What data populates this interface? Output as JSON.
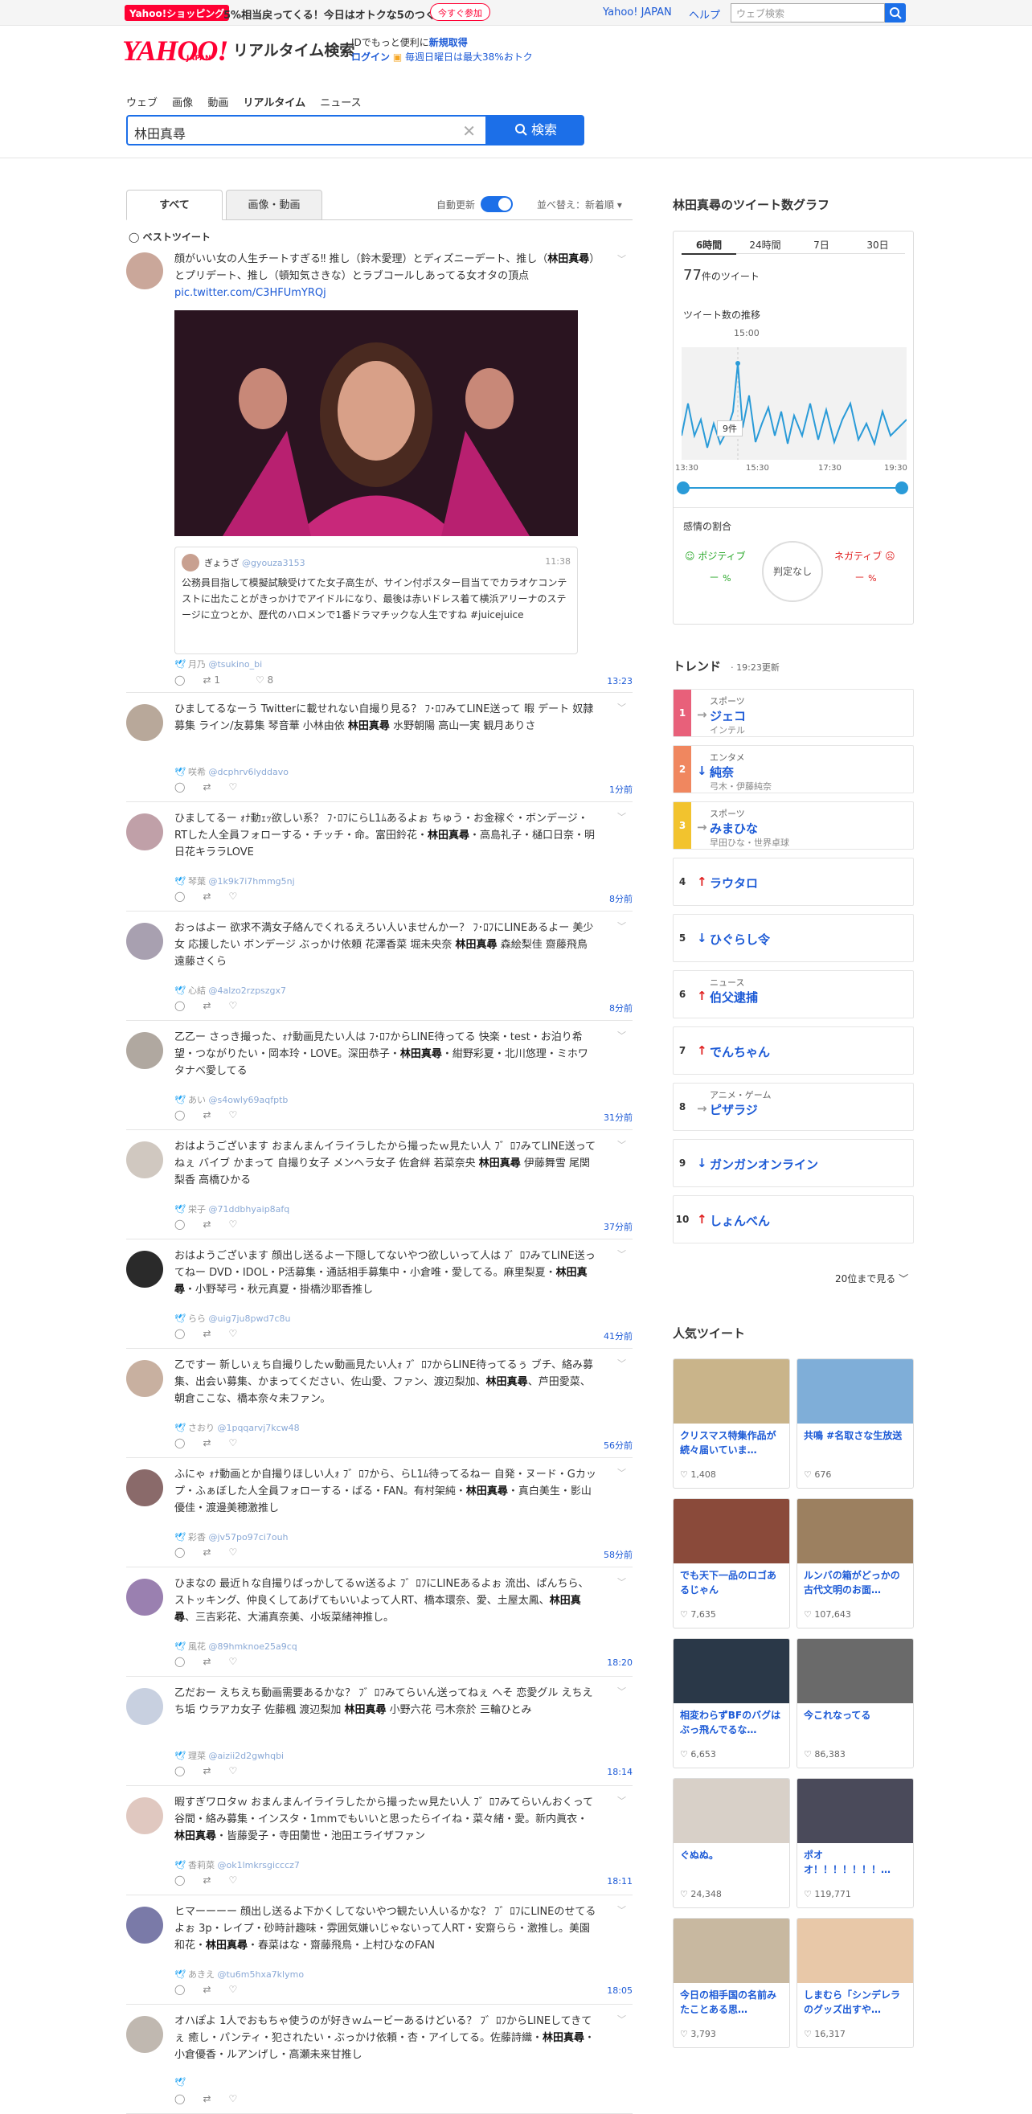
{
  "header": {
    "promo_badge": "Yahoo!ショッピング",
    "promo_text": "5%相当戻ってくる！今日はオトクな5のつく日",
    "promo_button": "今すぐ参加",
    "links": [
      "Yahoo! JAPAN",
      "ヘルプ"
    ],
    "top_search_placeholder": "ウェブ検索",
    "logo": "YAHOO!",
    "logo_sub": "JAPAN",
    "service_title": "リアルタイム検索",
    "login_line1_prefix": "IDでもっと便利に",
    "login_line1_link": "新規取得",
    "login_link": "ログイン",
    "login_promo": "毎週日曜日は最大38%おトク"
  },
  "nav": [
    "ウェブ",
    "画像",
    "動画",
    "リアルタイム",
    "ニュース"
  ],
  "search": {
    "value": "林田真尋",
    "button": "検索"
  },
  "tabs": {
    "all": "すべて",
    "media": "画像・動画",
    "auto_update": "自動更新",
    "sort": "並べ替え：新着順"
  },
  "best_tweet_label": "ベストツイート",
  "tweets": [
    {
      "body_pre": "顔がいい女の人生チートすぎる‼︎ 推し（鈴木愛理）とディズニーデート、推し（",
      "kw": "林田真尋",
      "body_post": "）とプリデート、推し（頓知気さきな）とラブコールしあってる女オタの頂点 ",
      "link": "pic.twitter.com/C3HFUmYRQj",
      "user": "月乃",
      "handle": "@tsukino_bi",
      "retweets": "1",
      "likes": "8",
      "time": "13:23",
      "quote": {
        "user": "ぎょうざ",
        "handle": "@gyouza3153",
        "time": "11:38",
        "text": "公務員目指して模擬試験受けてた女子高生が、サイン付ポスター目当てでカラオケコンテストに出たことがきっかけでアイドルになり、最後は赤いドレス着て横浜アリーナのステージに立つとか、歴代のハロメンで1番ドラマチックな人生ですね #juicejuice"
      }
    },
    {
      "body_pre": "ひましてるなーう Twitterに載せれない自撮り見る？ ﾌ･ﾛﾌみてLINE送って 暇 デート 奴隷募集 ライン/友募集 琴音華 小林由依 ",
      "kw": "林田真尋",
      "body_post": " 水野朝陽 高山一実 観月ありさ",
      "user": "咲希",
      "handle": "@dcphrv6lyddavo",
      "time": "1分前"
    },
    {
      "body_pre": "ひましてるー ｫﾅ動ｪｯ欲しい系？ ﾌ･ﾛﾌにらL1ﾑあるよぉ ちゅう・お金稼ぐ・ボンデージ・RTした人全員フォローする・チッチ・命。富田鈴花・",
      "kw": "林田真尋",
      "body_post": "・高島礼子・樋口日奈・明日花キララLOVE",
      "user": "琴葉",
      "handle": "@1k9k7i7hmmg5nj",
      "time": "8分前"
    },
    {
      "body_pre": "おっはよー 欲求不満女子絡んでくれるえろい人いませんかー？ ﾌ･ﾛﾌにLINEあるよー 美少女 応援したい ボンデージ ぶっかけ依頼 花澤香菜 堀未央奈 ",
      "kw": "林田真尋",
      "body_post": " 森絵梨佳 齋藤飛鳥 遠藤さくら",
      "user": "心結",
      "handle": "@4alzo2rzpszgx7",
      "time": "8分前"
    },
    {
      "body_pre": "乙乙ー さっき撮った、ｫﾅ動画見たい人は ﾌ･ﾛﾌからLINE待ってる 快楽・test・お泊り希望・つながりたい・岡本玲・LOVE。深田恭子・",
      "kw": "林田真尋",
      "body_post": "・紺野彩夏・北川悠理・ミホワタナベ愛してる",
      "user": "あい",
      "handle": "@s4owly69aqfptb",
      "time": "31分前"
    },
    {
      "body_pre": "おはようございます おまんまんイライラしたから撮ったｗ見たい人 ﾌ゛ﾛﾌみてLINE送ってねぇ バイブ かまって 自撮り女子 メンヘラ女子 佐倉絆 若菜奈央 ",
      "kw": "林田真尋",
      "body_post": " 伊藤舞雪 尾関梨香 高橋ひかる",
      "user": "栄子",
      "handle": "@71ddbhyaip8afq",
      "time": "37分前"
    },
    {
      "body_pre": "おはようございます 顔出し送るよー下隠してないやつ欲しいって人は ﾌ゛ﾛﾌみてLINE送ってねー DVD・IDOL・P活募集・通話相手募集中・小倉唯・愛してる。麻里梨夏・",
      "kw": "林田真尋",
      "body_post": "・小野琴弓・秋元真夏・掛橋沙耶香推し",
      "user": "らら",
      "handle": "@uig7ju8pwd7c8u",
      "time": "41分前"
    },
    {
      "body_pre": "乙ですー 新しいぇち自撮りしたｗ動画見たい人ｫ ﾌ゛ﾛﾌからLINE待ってるぅ ブチ、絡み募集、出会い募集、かまってください、佐山愛、ファン、渡辺梨加、",
      "kw": "林田真尋",
      "body_post": "、芦田愛菜、朝倉ここな、橋本奈々未ファン。",
      "user": "さおり",
      "handle": "@1pqqarvj7kcw48",
      "time": "56分前"
    },
    {
      "body_pre": "ふにゃ ｫﾅ動画とか自撮りほしい人ｫ ﾌ゛ﾛﾌから、らL1ﾑ待ってるねー 自発・ヌード・Gカップ・ふぁぼした人全員フォローする・ばる・FAN。有村架純・",
      "kw": "林田真尋",
      "body_post": "・真白美生・影山優佳・渡邊美穂激推し",
      "user": "彩香",
      "handle": "@jv57po97ci7ouh",
      "time": "58分前"
    },
    {
      "body_pre": "ひまなの 最近ｈな自撮りばっかしてるｗ送るよ ﾌ゛ﾛﾌにLINEあるよぉ 流出、ぱんちら、ストッキング、仲良くしてあげてもいいよって人RT、橋本環奈、愛、土屋太鳳、",
      "kw": "林田真尋",
      "body_post": "、三吉彩花、大浦真奈美、小坂菜緒神推し。",
      "user": "風花",
      "handle": "@89hmknoe25a9cq",
      "time": "18:20"
    },
    {
      "body_pre": "乙だおー えちえち動画需要あるかな？ ﾌ゛ﾛﾌみてらいん送ってねぇ へそ 恋愛グル えちえち垢 ウラアカ女子 佐藤楓 渡辺梨加 ",
      "kw": "林田真尋",
      "body_post": " 小野六花 弓木奈於 三輪ひとみ",
      "user": "理菜",
      "handle": "@aizii2d2gwhqbi",
      "time": "18:14"
    },
    {
      "body_pre": "暇すぎワロタｗ おまんまんイライラしたから撮ったｗ見たい人 ﾌ゛ﾛﾌみてらいんおくって 谷間・絡み募集・インスタ・1mmでもいいと思ったらイイね・菜々緒・愛。新内眞衣・",
      "kw": "林田真尋",
      "body_post": "・皆藤愛子・寺田蘭世・池田エライザファン",
      "user": "香莉菜",
      "handle": "@ok1lmkrsgicccz7",
      "time": "18:11"
    },
    {
      "body_pre": "ヒマーーーー 顔出し送るよ下かくしてないやつ観たい人いるかな？ ﾌ゛ﾛﾌにLINEのせてるよぉ 3p・レイプ・砂時計趣味・雰囲気嫌いじゃないって人RT・安齋らら・激推し。美園和花・",
      "kw": "林田真尋",
      "body_post": "・春菜はな・齋藤飛鳥・上村ひなのFAN",
      "user": "あきえ",
      "handle": "@tu6m5hxa7klymo",
      "time": "18:05"
    },
    {
      "body_pre": "オハぽよ 1人でおもちゃ使うのが好きｗムービーあるけどいる？ ﾌ゛ﾛﾌからLINEしてきてぇ 癒し・パンティ・犯されたい・ぶっかけ依頼・杏・アイしてる。佐藤詩織・",
      "kw": "林田真尋",
      "body_post": "・小倉優香・ルアンげし・高瀬未来甘推し",
      "user": "",
      "handle": "",
      "time": ""
    }
  ],
  "graph": {
    "title": "林田真尋のツイート数グラフ",
    "tabs": [
      "6時間",
      "24時間",
      "7日",
      "30日"
    ],
    "count": "77",
    "count_suffix": "件のツイート",
    "trend_label": "ツイート数の推移",
    "peak_label": "15:00",
    "tooltip": "9件",
    "x_labels": [
      "13:30",
      "15:30",
      "17:30",
      "19:30"
    ],
    "sentiment_title": "感情の割合",
    "positive": "ポジティブ",
    "negative": "ネガティブ",
    "neutral": "判定なし",
    "pos_value": "－",
    "neg_value": "－",
    "pct": "%"
  },
  "trend": {
    "title": "トレンド",
    "updated": "19:23更新",
    "items": [
      {
        "rank": "1",
        "cat": "スポーツ",
        "word": "ジェコ",
        "sub": "インテル",
        "dir": "→",
        "color": "#e8607a"
      },
      {
        "rank": "2",
        "cat": "エンタメ",
        "word": "純奈",
        "sub": "弓木・伊藤純奈",
        "dir": "↓",
        "color": "#f0875f"
      },
      {
        "rank": "3",
        "cat": "スポーツ",
        "word": "みまひな",
        "sub": "早田ひな・世界卓球",
        "dir": "→",
        "color": "#f2c32e"
      },
      {
        "rank": "4",
        "cat": "",
        "word": "ラウタロ",
        "sub": "",
        "dir": "↑",
        "color": ""
      },
      {
        "rank": "5",
        "cat": "",
        "word": "ひぐらし令",
        "sub": "",
        "dir": "↓",
        "color": ""
      },
      {
        "rank": "6",
        "cat": "ニュース",
        "word": "伯父逮捕",
        "sub": "",
        "dir": "↑",
        "color": ""
      },
      {
        "rank": "7",
        "cat": "",
        "word": "でんちゃん",
        "sub": "",
        "dir": "↑",
        "color": ""
      },
      {
        "rank": "8",
        "cat": "アニメ・ゲーム",
        "word": "ピザラジ",
        "sub": "",
        "dir": "→",
        "color": ""
      },
      {
        "rank": "9",
        "cat": "",
        "word": "ガンガンオンライン",
        "sub": "",
        "dir": "↓",
        "color": ""
      },
      {
        "rank": "10",
        "cat": "",
        "word": "しょんべん",
        "sub": "",
        "dir": "↑",
        "color": ""
      }
    ],
    "more": "20位まで見る"
  },
  "popular": {
    "title": "人気ツイート",
    "cards": [
      {
        "text": "クリスマス特集作品が続々届いていま…",
        "likes": "1,408",
        "bg": "#c9b48a"
      },
      {
        "text": "共鳴 #名取さな生放送",
        "likes": "676",
        "bg": "#7faed8"
      },
      {
        "text": "でも天下一品のロゴあるじゃん",
        "likes": "7,635",
        "bg": "#8a4a3a"
      },
      {
        "text": "ルンバの箱がどっかの古代文明のお面…",
        "likes": "107,643",
        "bg": "#9c8060"
      },
      {
        "text": "相変わらずBFのバグはぶっ飛んでるな…",
        "likes": "6,653",
        "bg": "#2a3848"
      },
      {
        "text": "今これなってる",
        "likes": "86,383",
        "bg": "#6a6a6a"
      },
      {
        "text": "ぐぬぬ。",
        "likes": "24,348",
        "bg": "#d8d0c8"
      },
      {
        "text": "ポオオ！！！！！！！…",
        "likes": "119,771",
        "bg": "#4a4a5a"
      },
      {
        "text": "今日の相手国の名前みたことある思…",
        "likes": "3,793",
        "bg": "#c8b8a0"
      },
      {
        "text": "しまむら「シンデレラのグッズ出すや…",
        "likes": "16,317",
        "bg": "#e8c8a8"
      }
    ]
  }
}
